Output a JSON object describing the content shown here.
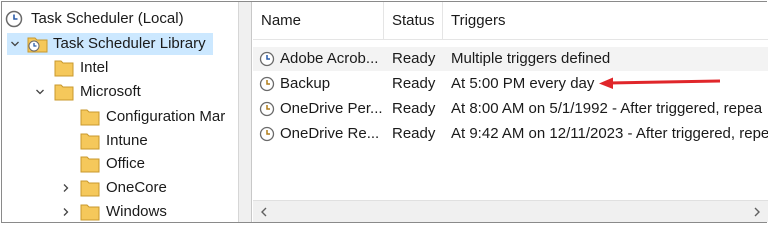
{
  "tree": {
    "items": [
      {
        "label": "Task Scheduler (Local)",
        "icon": "clock-icon",
        "expander": ""
      },
      {
        "label": "Task Scheduler Library",
        "icon": "folder-clock-icon",
        "expander": "expanded"
      },
      {
        "label": "Intel",
        "icon": "folder-icon",
        "expander": ""
      },
      {
        "label": "Microsoft",
        "icon": "folder-icon",
        "expander": "expanded"
      },
      {
        "label": "Configuration Mar",
        "icon": "folder-icon",
        "expander": ""
      },
      {
        "label": "Intune",
        "icon": "folder-icon",
        "expander": ""
      },
      {
        "label": "Office",
        "icon": "folder-icon",
        "expander": ""
      },
      {
        "label": "OneCore",
        "icon": "folder-icon",
        "expander": "collapsed"
      },
      {
        "label": "Windows",
        "icon": "folder-icon",
        "expander": "collapsed"
      }
    ],
    "selected": "Task Scheduler Library"
  },
  "list": {
    "columns": [
      "Name",
      "Status",
      "Triggers"
    ],
    "rows": [
      {
        "name": "Adobe Acrob...",
        "status": "Ready",
        "triggers": "Multiple triggers defined",
        "icon": "task-clock-icon"
      },
      {
        "name": "Backup",
        "status": "Ready",
        "triggers": "At 5:00 PM every day",
        "icon": "task-clock-icon"
      },
      {
        "name": "OneDrive Per...",
        "status": "Ready",
        "triggers": "At 8:00 AM on 5/1/1992 - After triggered, repea",
        "icon": "task-clock-icon"
      },
      {
        "name": "OneDrive Re...",
        "status": "Ready",
        "triggers": "At 9:42 AM on 12/11/2023 - After triggered, repe",
        "icon": "task-clock-icon"
      }
    ]
  },
  "colors": {
    "selection": "#cce8ff",
    "folder": "#f5c85b",
    "annotation_arrow": "#e0262a"
  }
}
